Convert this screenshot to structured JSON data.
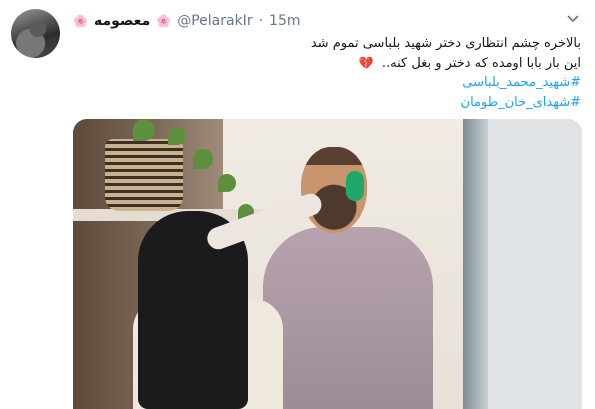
{
  "tweet": {
    "display_name": "معصومه",
    "handle": "@PelarakIr",
    "separator": "·",
    "time": "15m",
    "decor": "🌸",
    "heart": "💔",
    "text_lines": [
      "بالاخره چشم انتظاری دختر شهید بلباسی تموم شد",
      "این بار بابا اومده که دختر و بغل کنه.."
    ],
    "hashtags": [
      "#شهید_محمد_بلباسی",
      "#شهدای_خان_طومان"
    ]
  },
  "icons": {
    "more": "chevron-down-icon"
  }
}
